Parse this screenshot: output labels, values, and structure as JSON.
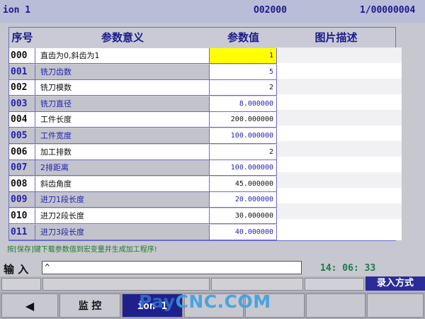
{
  "header": {
    "program": "ion 1",
    "o_number": "O02000",
    "position": "1/00000004"
  },
  "table": {
    "columns": [
      "序号",
      "参数意义",
      "参数值",
      "图片描述"
    ],
    "rows": [
      {
        "no": "000",
        "name": "直齿为0,斜齿为1",
        "value": "1"
      },
      {
        "no": "001",
        "name": "铣刀齿数",
        "value": "5"
      },
      {
        "no": "002",
        "name": "铣刀模数",
        "value": "2"
      },
      {
        "no": "003",
        "name": "铣刀直径",
        "value": "8.000000"
      },
      {
        "no": "004",
        "name": "工件长度",
        "value": "200.000000"
      },
      {
        "no": "005",
        "name": "工件宽度",
        "value": "100.000000"
      },
      {
        "no": "006",
        "name": "加工排数",
        "value": "2"
      },
      {
        "no": "007",
        "name": "2排距离",
        "value": "100.000000"
      },
      {
        "no": "008",
        "name": "斜齿角度",
        "value": "45.000000"
      },
      {
        "no": "009",
        "name": "进刀1段长度",
        "value": "20.000000"
      },
      {
        "no": "010",
        "name": "进刀2段长度",
        "value": "30.000000"
      },
      {
        "no": "011",
        "name": "进刀3段长度",
        "value": "40.000000"
      }
    ],
    "selected_row": 0
  },
  "message": "按[保存]键下载参数值到宏变量并生成加工程序!",
  "input": {
    "label": "输 入",
    "value": "^"
  },
  "clock": "14: 06: 33",
  "mode": "录入方式",
  "softkeys": {
    "back": "◀",
    "monitor": "监 控",
    "program": "ion 1"
  },
  "watermark": {
    "pay": "Pay",
    "cnc": "CNC.COM"
  },
  "colors": {
    "header_bg": "#b9bdd8",
    "text_blue": "#2323b0",
    "selected": "#ffff00",
    "mode_bg": "#2b2b9c",
    "message_green": "#1c7a2a"
  }
}
